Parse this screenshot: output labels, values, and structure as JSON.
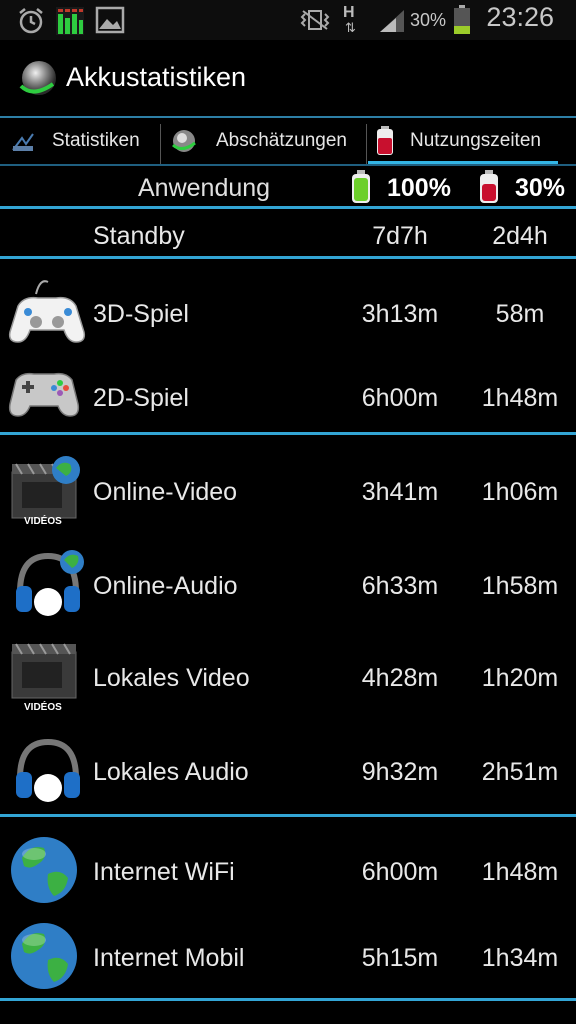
{
  "status": {
    "battery_pct": "30%",
    "time": "23:26",
    "network": "H"
  },
  "app": {
    "title": "Akkustatistiken"
  },
  "tabs": [
    {
      "label": "Statistiken",
      "active": false
    },
    {
      "label": "Abschätzungen",
      "active": false
    },
    {
      "label": "Nutzungszeiten",
      "active": true
    }
  ],
  "header": {
    "app_col": "Anwendung",
    "full": "100%",
    "low": "30%"
  },
  "rows": [
    {
      "label": "Standby",
      "full": "7d7h",
      "low": "2d4h",
      "icon": "none"
    },
    {
      "label": "3D-Spiel",
      "full": "3h13m",
      "low": "58m",
      "icon": "gamepad-white-icon"
    },
    {
      "label": "2D-Spiel",
      "full": "6h00m",
      "low": "1h48m",
      "icon": "gamepad-grey-icon"
    },
    {
      "label": "Online-Video",
      "full": "3h41m",
      "low": "1h06m",
      "icon": "video-globe-icon"
    },
    {
      "label": "Online-Audio",
      "full": "6h33m",
      "low": "1h58m",
      "icon": "headphones-globe-icon"
    },
    {
      "label": "Lokales Video",
      "full": "4h28m",
      "low": "1h20m",
      "icon": "video-icon"
    },
    {
      "label": "Lokales Audio",
      "full": "9h32m",
      "low": "2h51m",
      "icon": "headphones-icon"
    },
    {
      "label": "Internet WiFi",
      "full": "6h00m",
      "low": "1h48m",
      "icon": "globe-icon"
    },
    {
      "label": "Internet Mobil",
      "full": "5h15m",
      "low": "1h34m",
      "icon": "globe-icon"
    }
  ],
  "icon_text": {
    "videos": "VIDÉOS"
  },
  "colors": {
    "accent": "#33b5e5",
    "battery_full": "#6ccf2a",
    "battery_low": "#c8102e"
  }
}
